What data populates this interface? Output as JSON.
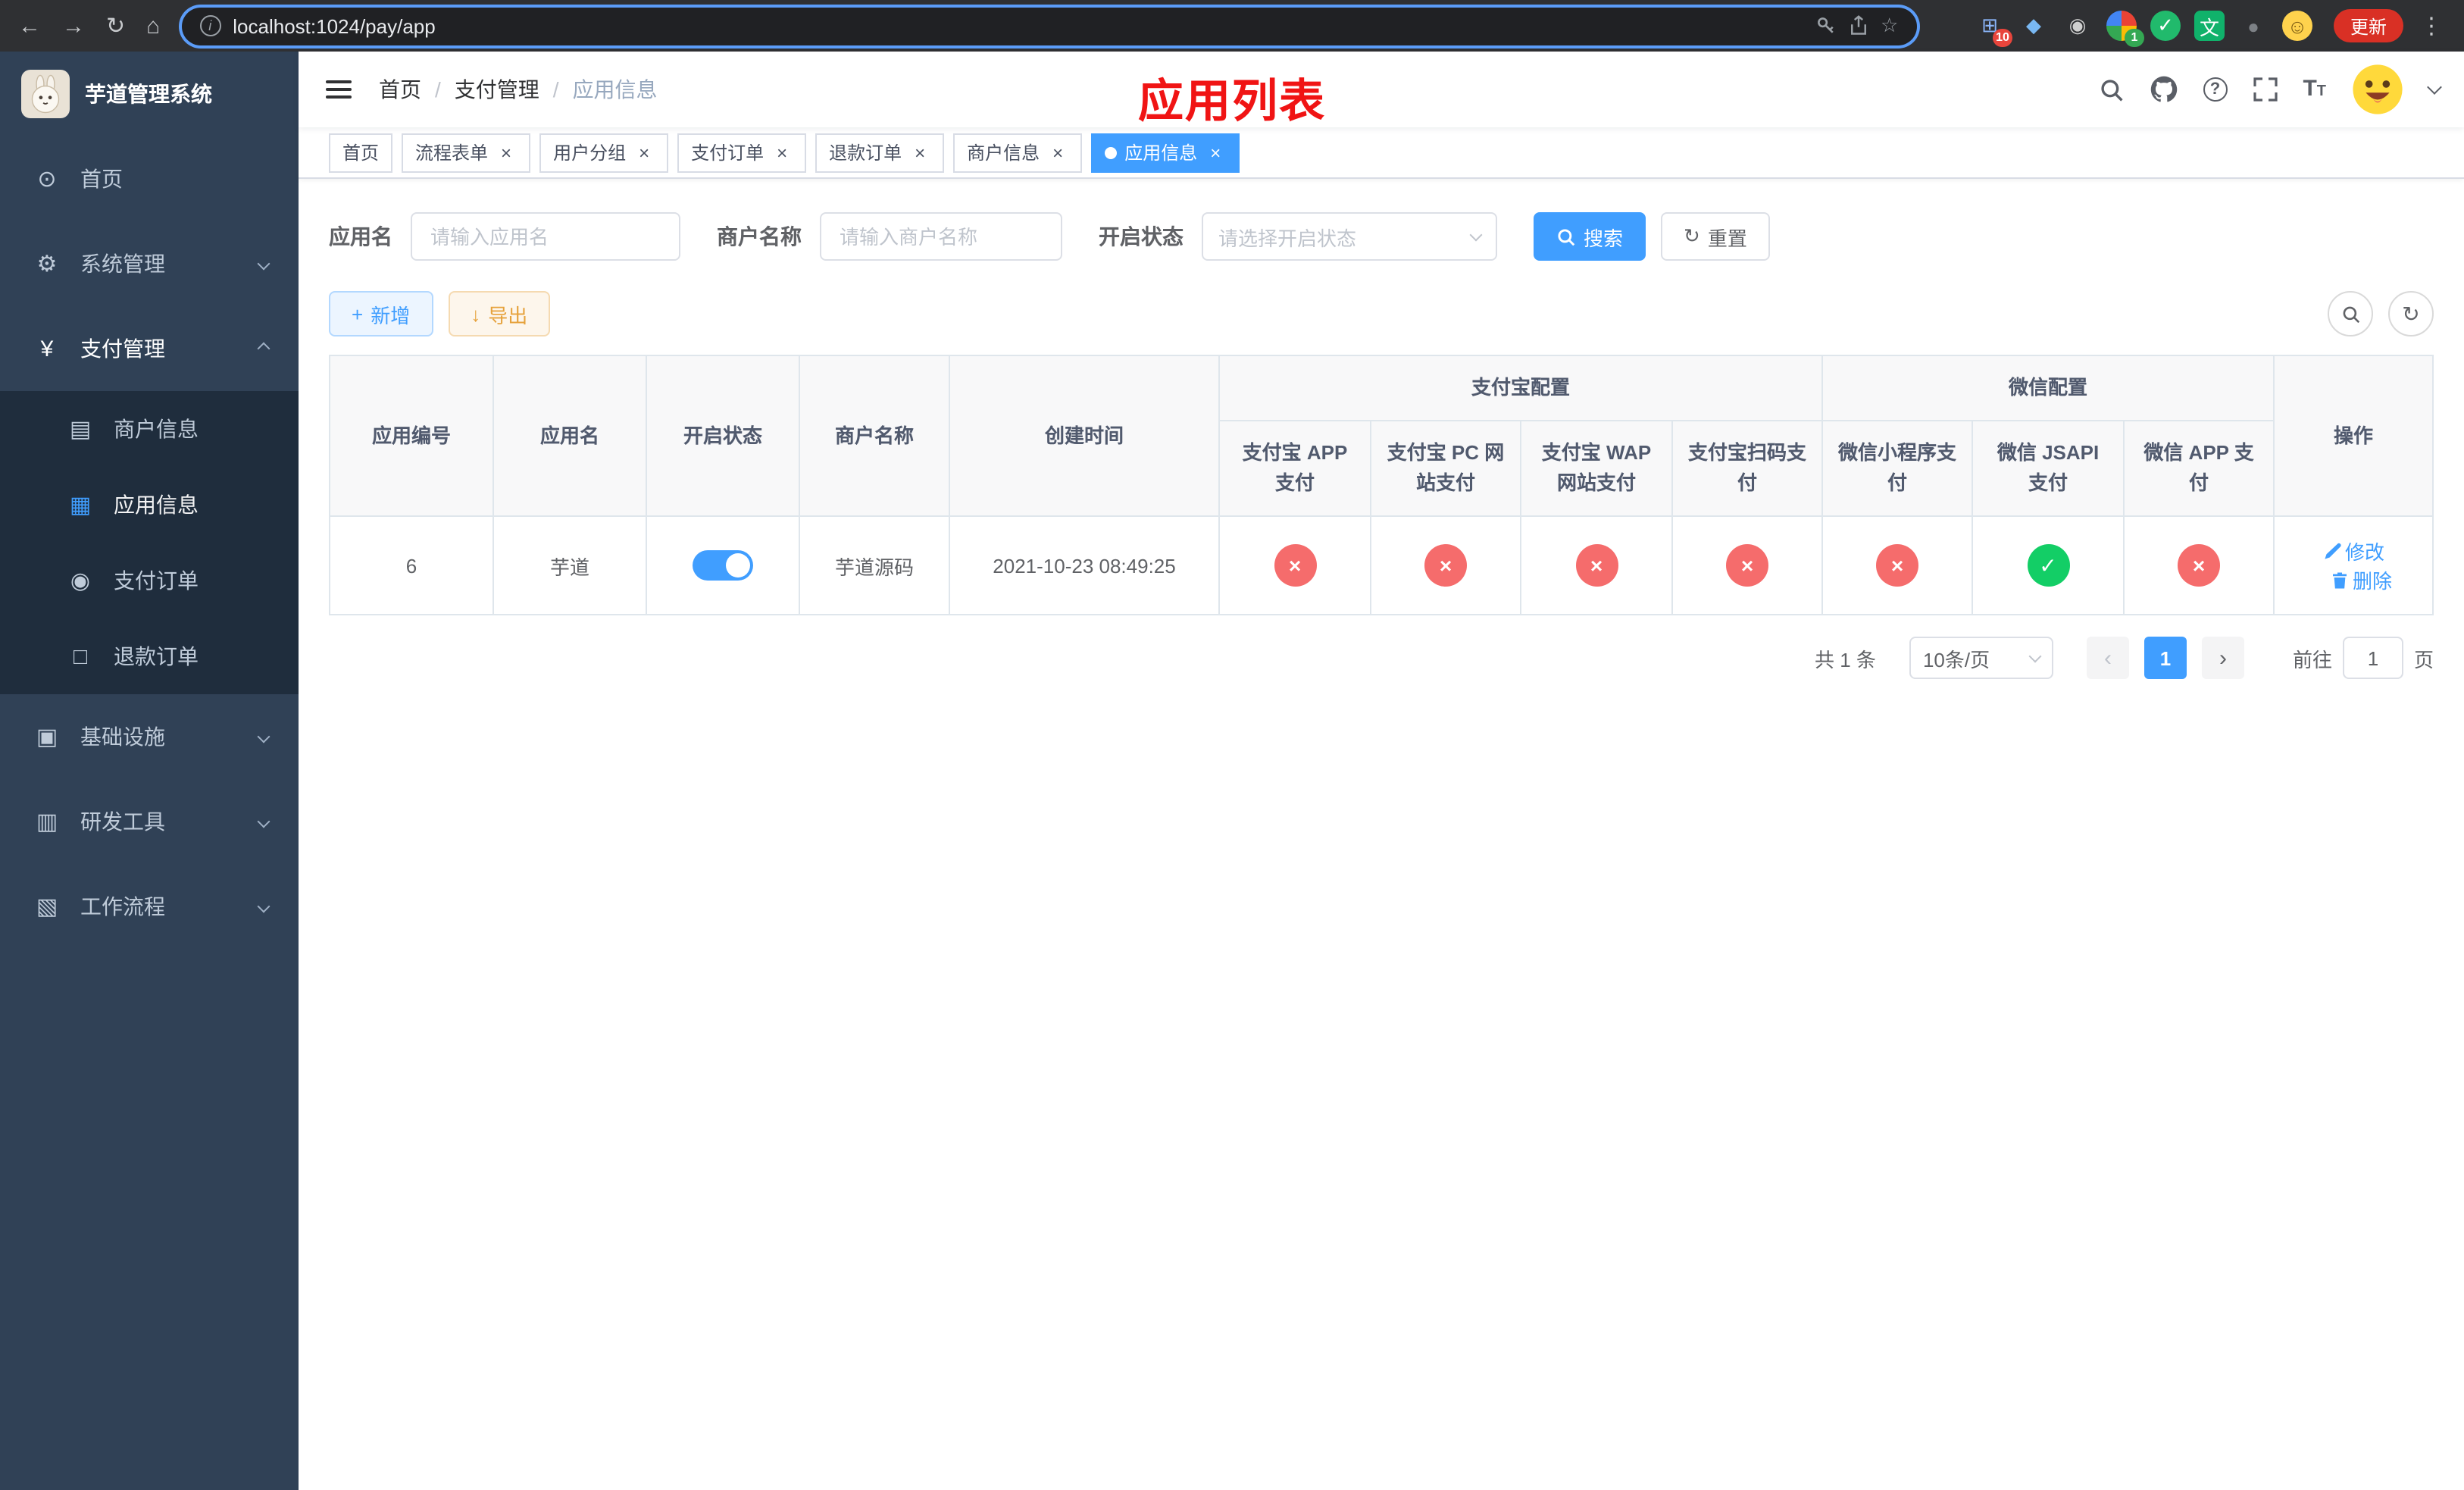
{
  "browser": {
    "url": "localhost:1024/pay/app",
    "update_label": "更新",
    "nav": {
      "back": "←",
      "forward": "→",
      "reload": "↻",
      "home": "⌂"
    },
    "extensions": [
      {
        "icon": "puzzle-extension-icon",
        "glyph": "⊞",
        "fg": "#8ab4f8",
        "badge": "10",
        "badge_bg": "#e8453c"
      },
      {
        "icon": "diamond-extension-icon",
        "glyph": "◆",
        "fg": "#79b8f3"
      },
      {
        "icon": "dark-circle-extension-icon",
        "glyph": "◉",
        "fg": "#cfcfcf"
      },
      {
        "icon": "color-wheel-extension-icon",
        "glyph": "",
        "bg": "conic-gradient(#ea4335 0 25%, #fbbc05 0 50%, #34a853 0 75%, #4285f4 0)",
        "round": true,
        "badge": "1",
        "badge_bg": "#34a853"
      },
      {
        "icon": "green-check-extension-icon",
        "glyph": "✓",
        "fg": "#ffffff",
        "bg": "#21ba6c",
        "round": true
      },
      {
        "icon": "green-chat-extension-icon",
        "glyph": "文",
        "fg": "#ffffff",
        "bg": "#10b26b"
      },
      {
        "icon": "dark-shape-extension-icon",
        "glyph": "●",
        "fg": "#7d8186"
      },
      {
        "icon": "smiley-extension-icon",
        "glyph": "☺",
        "fg": "#7a5a12",
        "bg": "#ffd24d",
        "round": true
      }
    ]
  },
  "icons": {
    "info_glyph": "i",
    "star_glyph": "☆",
    "kebab_glyph": "⋮",
    "close_glyph": "×",
    "refresh_glyph": "↻",
    "plus_glyph": "+",
    "download_glyph": "↓",
    "question_glyph": "?",
    "font_size_large": "T",
    "font_size_small": "T"
  },
  "sidebar": {
    "logo_title": "芋道管理系统",
    "items": [
      {
        "label": "首页",
        "icon": "dashboard-icon",
        "glyph": "⊙"
      },
      {
        "label": "系统管理",
        "icon": "gear-icon",
        "glyph": "⚙",
        "arrow": true
      },
      {
        "label": "支付管理",
        "icon": "yen-icon",
        "glyph": "¥",
        "arrow": true,
        "arrow_up": true,
        "open": true
      },
      {
        "label": "商户信息",
        "icon": "merchant-card-icon",
        "glyph": "▤",
        "sub": true
      },
      {
        "label": "应用信息",
        "icon": "app-grid-icon",
        "glyph": "▦",
        "sub": true,
        "active": true
      },
      {
        "label": "支付订单",
        "icon": "pay-order-icon",
        "glyph": "◉",
        "sub": true
      },
      {
        "label": "退款订单",
        "icon": "refund-order-icon",
        "glyph": "□",
        "sub": true
      },
      {
        "label": "基础设施",
        "icon": "infrastructure-icon",
        "glyph": "▣",
        "arrow": true
      },
      {
        "label": "研发工具",
        "icon": "dev-tools-icon",
        "glyph": "▥",
        "arrow": true
      },
      {
        "label": "工作流程",
        "icon": "workflow-icon",
        "glyph": "▧",
        "arrow": true
      }
    ]
  },
  "header": {
    "breadcrumb": [
      "首页",
      "支付管理",
      "应用信息"
    ],
    "separator": "/",
    "page_title": "应用列表"
  },
  "tabs": [
    {
      "label": "首页"
    },
    {
      "label": "流程表单",
      "closable": true
    },
    {
      "label": "用户分组",
      "closable": true
    },
    {
      "label": "支付订单",
      "closable": true
    },
    {
      "label": "退款订单",
      "closable": true
    },
    {
      "label": "商户信息",
      "closable": true
    },
    {
      "label": "应用信息",
      "closable": true,
      "active": true,
      "dot": true
    }
  ],
  "filters": {
    "app_name_label": "应用名",
    "app_name_placeholder": "请输入应用名",
    "merchant_label": "商户名称",
    "merchant_placeholder": "请输入商户名称",
    "status_label": "开启状态",
    "status_placeholder": "请选择开启状态",
    "search_label": "搜索",
    "reset_label": "重置"
  },
  "toolbar": {
    "add_label": "新增",
    "export_label": "导出"
  },
  "table": {
    "main_columns": [
      "应用编号",
      "应用名",
      "开启状态",
      "商户名称",
      "创建时间"
    ],
    "group_columns": [
      "支付宝配置",
      "微信配置"
    ],
    "sub_columns": [
      "支付宝 APP 支付",
      "支付宝 PC 网站支付",
      "支付宝 WAP 网站支付",
      "支付宝扫码支付",
      "微信小程序支付",
      "微信 JSAPI 支付",
      "微信 APP 支付"
    ],
    "action_column": "操作",
    "status_glyphs": {
      "yes": "✓",
      "no": "×"
    },
    "rows": [
      {
        "id": "6",
        "name": "芋道",
        "enabled": true,
        "merchant": "芋道源码",
        "created": "2021-10-23 08:49:25",
        "statuses": [
          false,
          false,
          false,
          false,
          false,
          true,
          false
        ],
        "actions": [
          "修改",
          "删除"
        ]
      }
    ]
  },
  "pagination": {
    "total": "共 1 条",
    "page_size": "10条/页",
    "prev": "‹",
    "page": "1",
    "next": "›",
    "goto_prefix": "前往",
    "goto_value": "1",
    "goto_suffix": "页"
  }
}
